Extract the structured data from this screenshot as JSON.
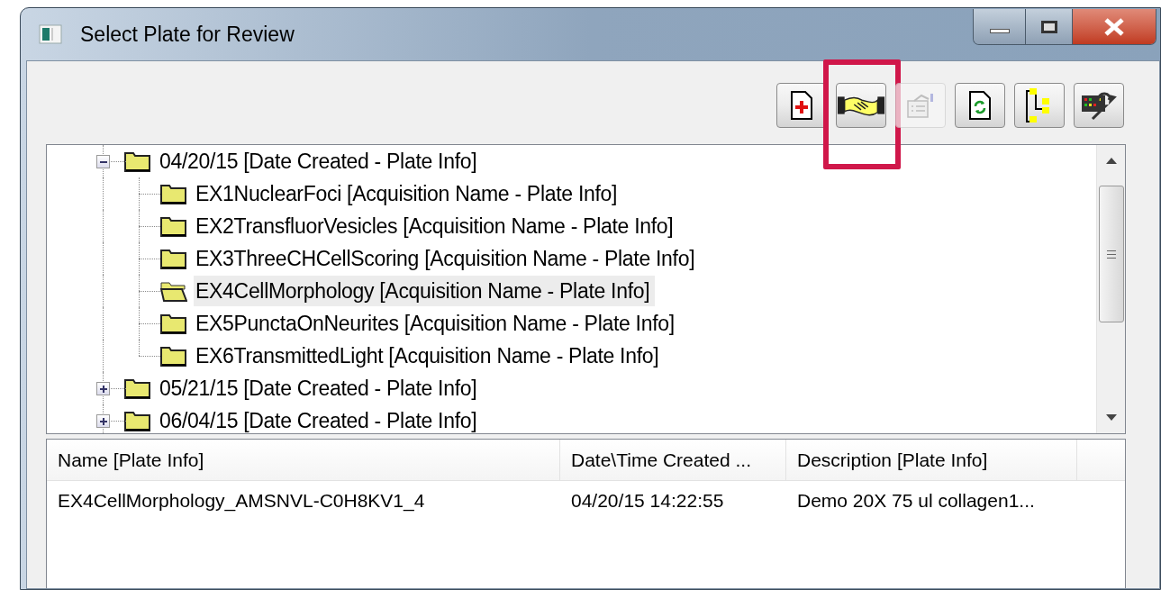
{
  "window": {
    "title": "Select Plate for Review"
  },
  "toolbar": {
    "buttons": [
      {
        "kind": "new",
        "disabled": false,
        "highlighted": false
      },
      {
        "kind": "handshake",
        "disabled": false,
        "highlighted": true
      },
      {
        "kind": "properties",
        "disabled": true,
        "highlighted": false
      },
      {
        "kind": "refresh",
        "disabled": false,
        "highlighted": false
      },
      {
        "kind": "tree",
        "disabled": false,
        "highlighted": false
      },
      {
        "kind": "tools",
        "disabled": false,
        "highlighted": false
      }
    ]
  },
  "tree": {
    "items": [
      {
        "label": "04/20/15 [Date Created - Plate Info]",
        "expanded": true,
        "selected": false,
        "children": [
          {
            "label": "EX1NuclearFoci [Acquisition Name - Plate Info]",
            "selected": false
          },
          {
            "label": "EX2TransfluorVesicles [Acquisition Name - Plate Info]",
            "selected": false
          },
          {
            "label": "EX3ThreeCHCellScoring [Acquisition Name - Plate Info]",
            "selected": false
          },
          {
            "label": "EX4CellMorphology [Acquisition Name - Plate Info]",
            "selected": true
          },
          {
            "label": "EX5PunctaOnNeurites [Acquisition Name - Plate Info]",
            "selected": false
          },
          {
            "label": "EX6TransmittedLight [Acquisition Name - Plate Info]",
            "selected": false
          }
        ]
      },
      {
        "label": "05/21/15 [Date Created - Plate Info]",
        "expanded": false,
        "selected": false
      },
      {
        "label": "06/04/15 [Date Created - Plate Info]",
        "expanded": false,
        "selected": false
      }
    ]
  },
  "list": {
    "columns": [
      "Name [Plate Info]",
      "Date\\Time Created ...",
      "Description [Plate Info]"
    ],
    "rows": [
      {
        "cells": [
          "EX4CellMorphology_AMSNVL-C0H8KV1_4",
          "04/20/15 14:22:55",
          "Demo 20X 75 ul collagen1..."
        ]
      }
    ]
  }
}
